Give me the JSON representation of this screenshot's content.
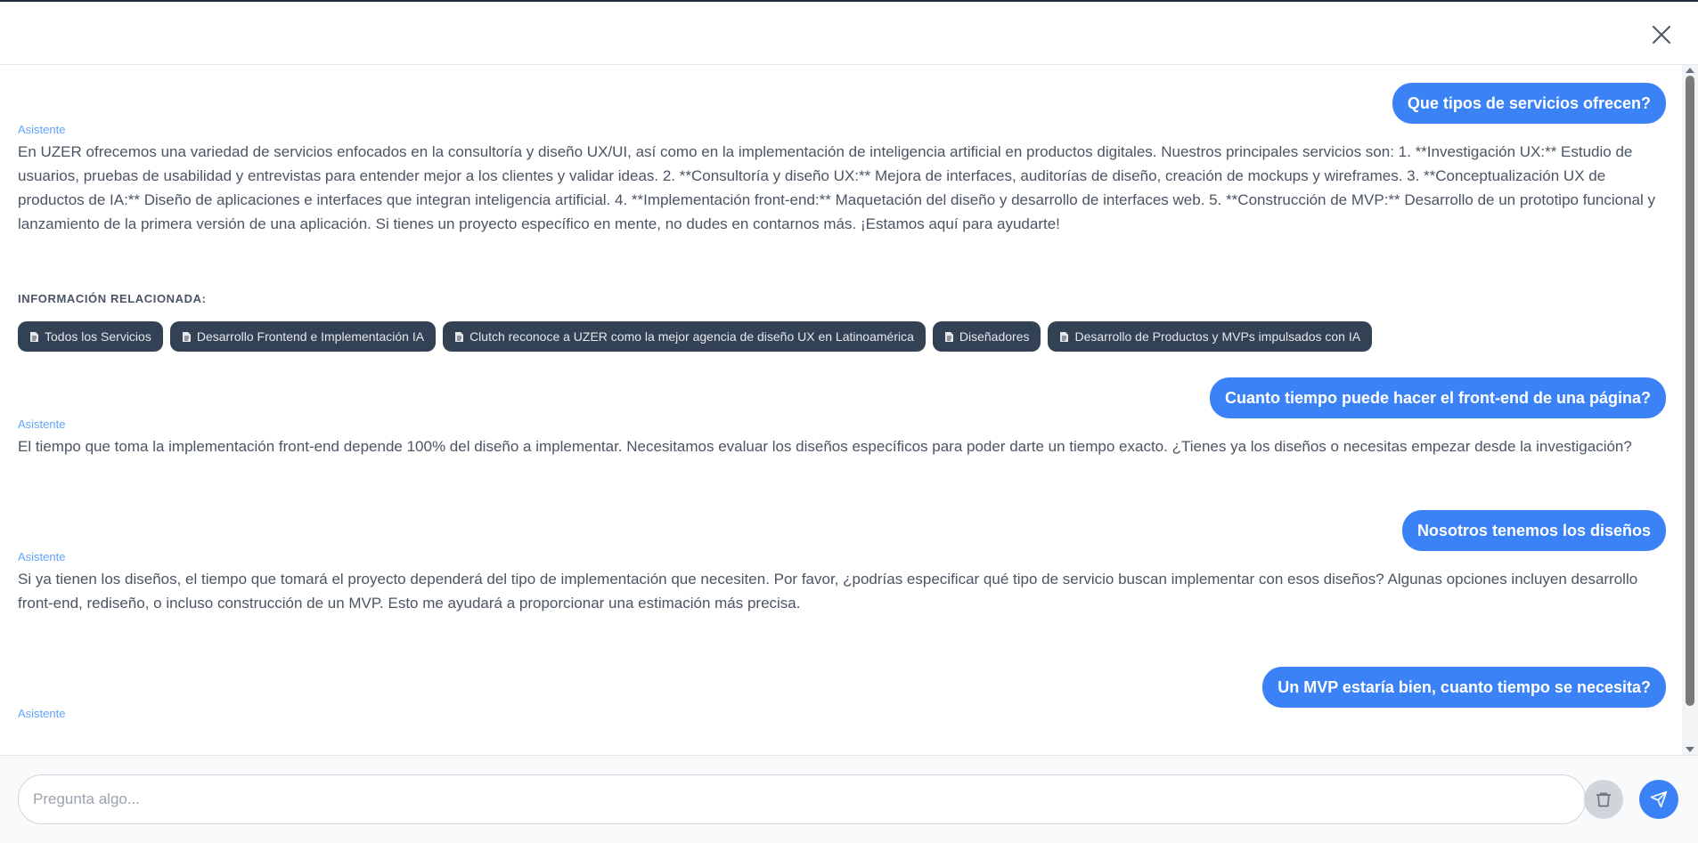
{
  "chat": {
    "messages": [
      {
        "role": "user",
        "text": "Que tipos de servicios ofrecen?"
      },
      {
        "role": "assistant",
        "label": "Asistente",
        "text": "En UZER ofrecemos una variedad de servicios enfocados en la consultoría y diseño UX/UI, así como en la implementación de inteligencia artificial en productos digitales. Nuestros principales servicios son: 1. **Investigación UX:** Estudio de usuarios, pruebas de usabilidad y entrevistas para entender mejor a los clientes y validar ideas. 2. **Consultoría y diseño UX:** Mejora de interfaces, auditorías de diseño, creación de mockups y wireframes. 3. **Conceptualización UX de productos de IA:** Diseño de aplicaciones e interfaces que integran inteligencia artificial. 4. **Implementación front-end:** Maquetación del diseño y desarrollo de interfaces web. 5. **Construcción de MVP:** Desarrollo de un prototipo funcional y lanzamiento de la primera versión de una aplicación. Si tienes un proyecto específico en mente, no dudes en contarnos más. ¡Estamos aquí para ayudarte!"
      },
      {
        "role": "user",
        "text": "Cuanto tiempo puede hacer el front-end de una página?"
      },
      {
        "role": "assistant",
        "label": "Asistente",
        "text": "El tiempo que toma la implementación front-end depende 100% del diseño a implementar. Necesitamos evaluar los diseños específicos para poder darte un tiempo exacto. ¿Tienes ya los diseños o necesitas empezar desde la investigación?"
      },
      {
        "role": "user",
        "text": "Nosotros tenemos los diseños"
      },
      {
        "role": "assistant",
        "label": "Asistente",
        "text": "Si ya tienen los diseños, el tiempo que tomará el proyecto dependerá del tipo de implementación que necesiten. Por favor, ¿podrías especificar qué tipo de servicio buscan implementar con esos diseños? Algunas opciones incluyen desarrollo front-end, rediseño, o incluso construcción de un MVP. Esto me ayudará a proporcionar una estimación más precisa."
      },
      {
        "role": "user",
        "text": "Un MVP estaría bien, cuanto tiempo se necesita?"
      },
      {
        "role": "assistant",
        "label": "Asistente",
        "text": ""
      }
    ],
    "related": {
      "title": "INFORMACIÓN RELACIONADA:",
      "icon": "document-icon",
      "chips": [
        "Todos los Servicios",
        "Desarrollo Frontend e Implementación IA",
        "Clutch reconoce a UZER como la mejor agencia de diseño UX en Latinoamérica",
        "Diseñadores",
        "Desarrollo de Productos y MVPs impulsados con IA"
      ]
    }
  },
  "footer": {
    "input_placeholder": "Pregunta algo...",
    "input_value": ""
  },
  "icons": {
    "close": "close-icon",
    "trash": "trash-icon",
    "send": "send-icon"
  },
  "colors": {
    "user_bubble": "#3b82f6",
    "chip_bg": "#334155",
    "assistant_label": "#60a5fa"
  }
}
